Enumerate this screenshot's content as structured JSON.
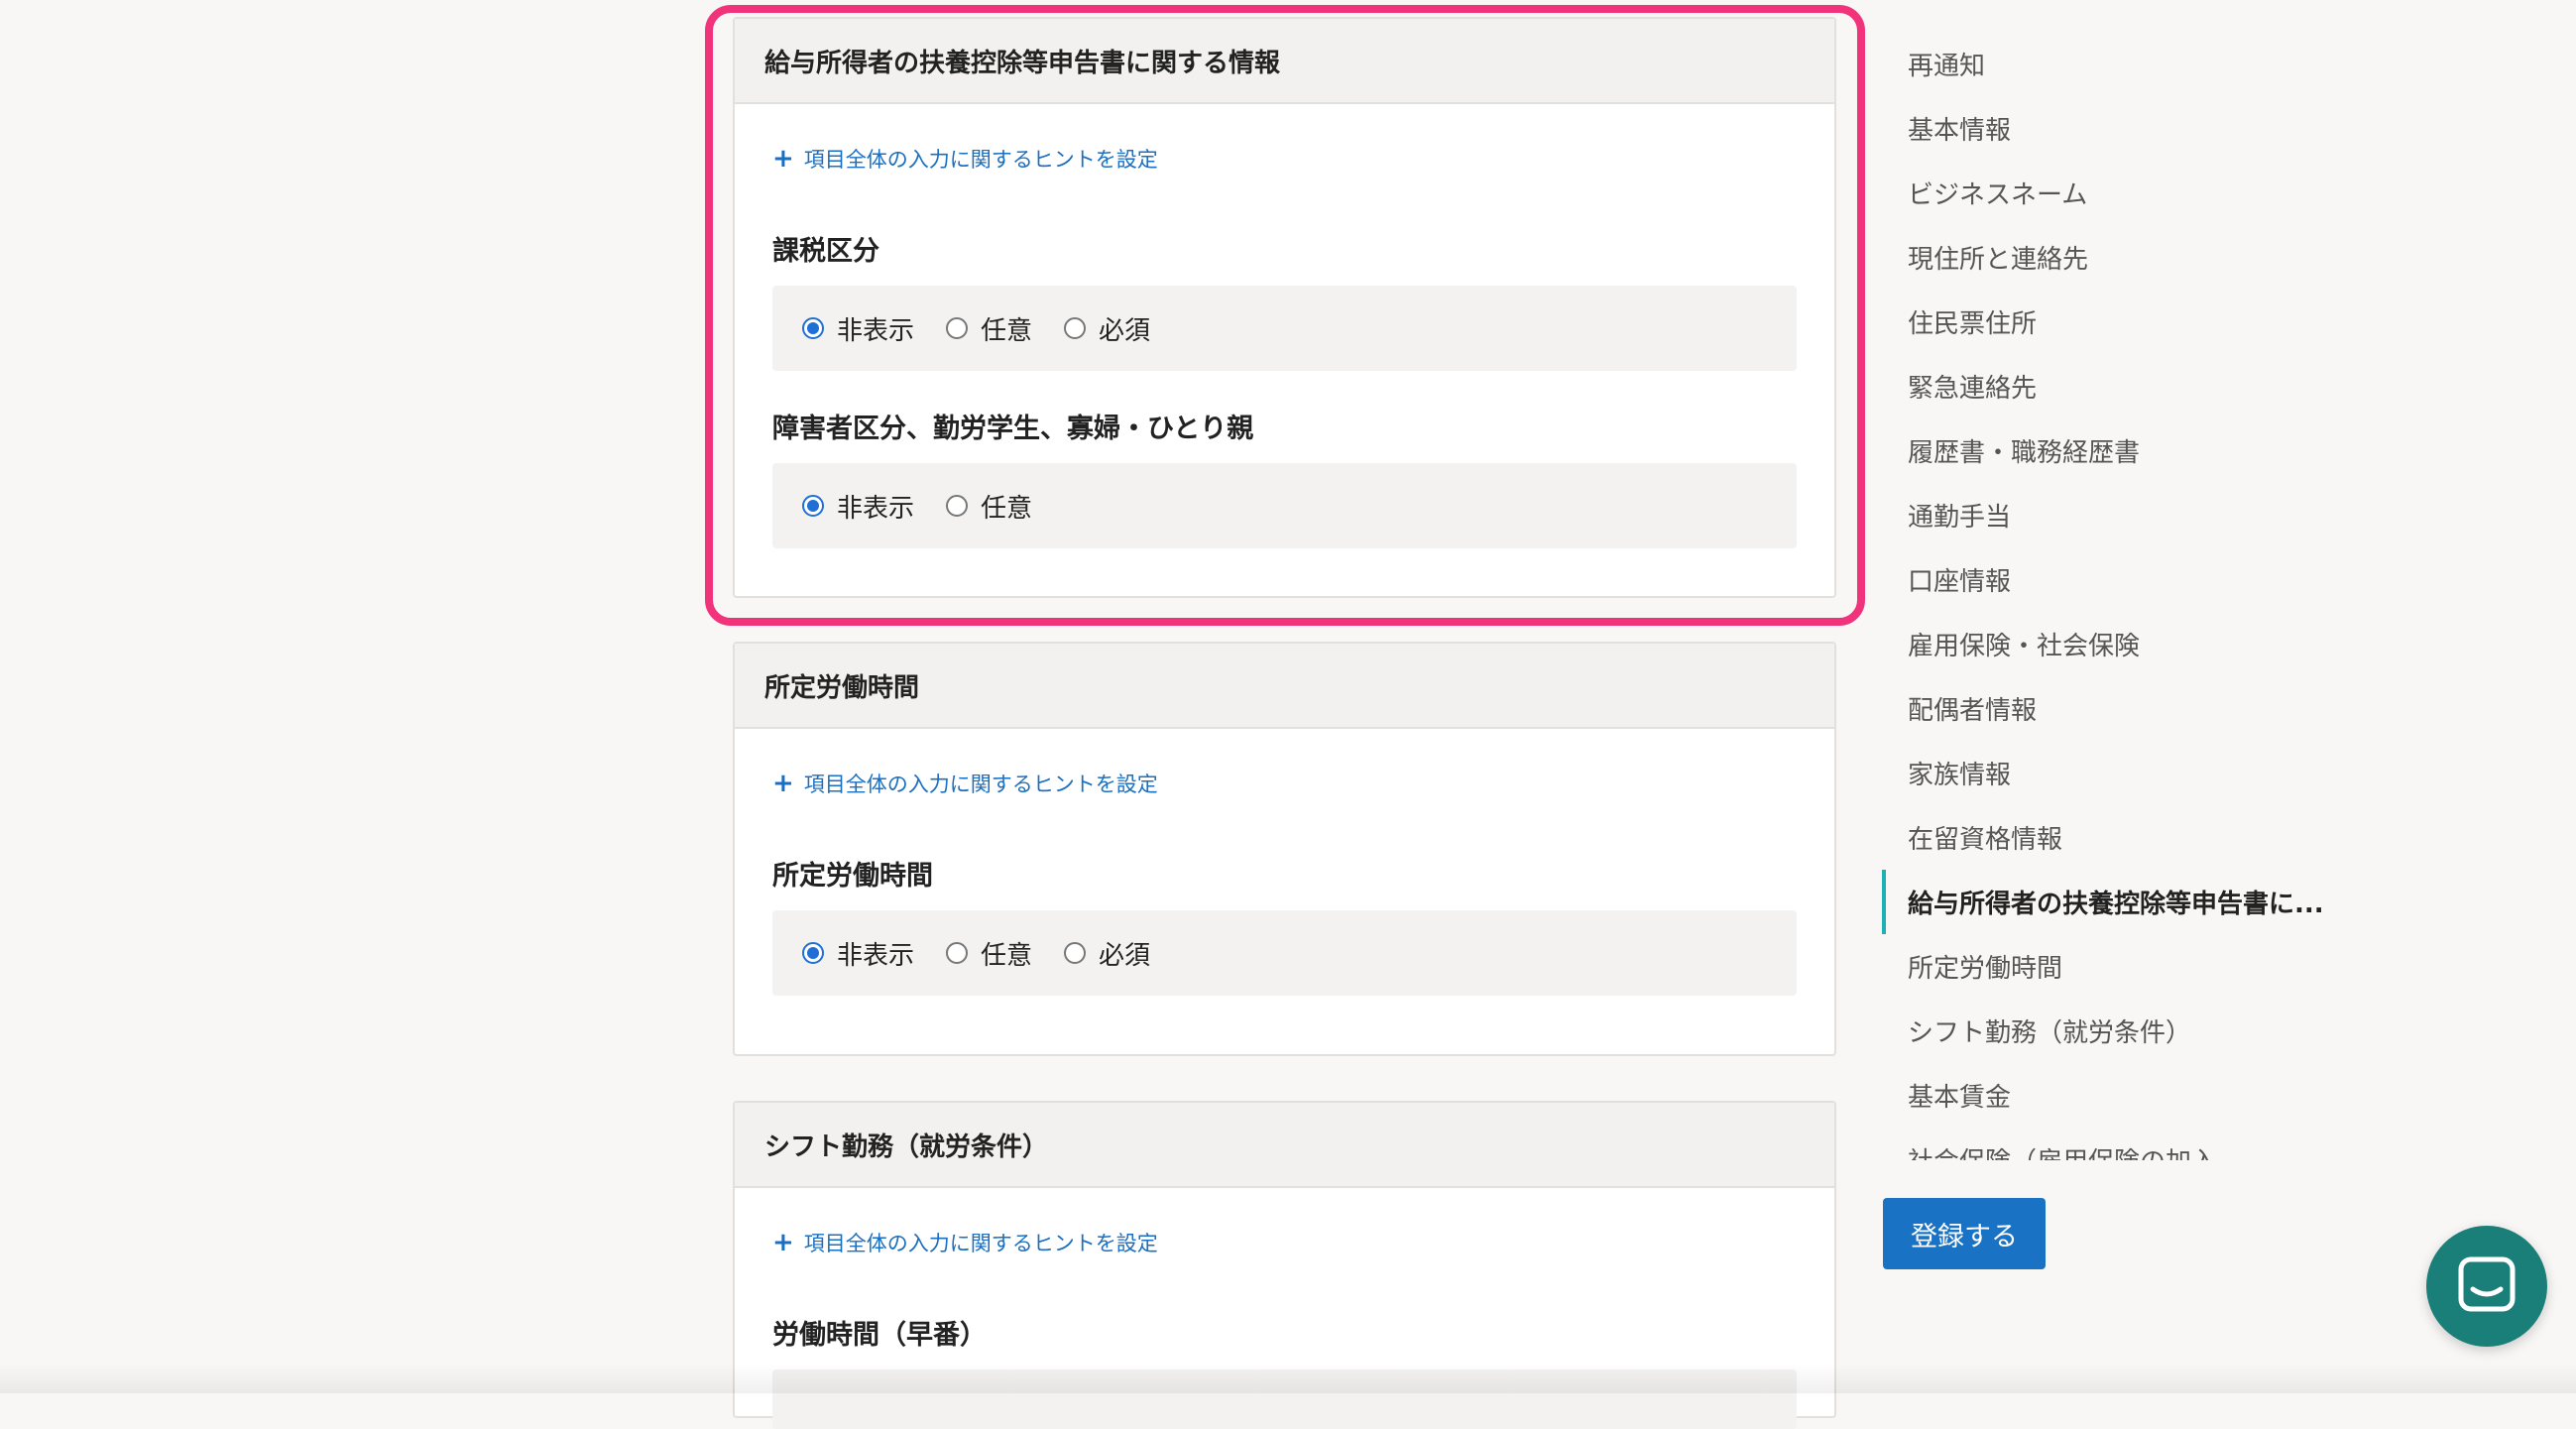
{
  "sections": [
    {
      "title": "給与所得者の扶養控除等申告書に関する情報",
      "hint": "項目全体の入力に関するヒントを設定",
      "fields": [
        {
          "label": "課税区分",
          "options": [
            "非表示",
            "任意",
            "必須"
          ],
          "selected": "非表示"
        },
        {
          "label": "障害者区分、勤労学生、寡婦・ひとり親",
          "options": [
            "非表示",
            "任意"
          ],
          "selected": "非表示"
        }
      ]
    },
    {
      "title": "所定労働時間",
      "hint": "項目全体の入力に関するヒントを設定",
      "fields": [
        {
          "label": "所定労働時間",
          "options": [
            "非表示",
            "任意",
            "必須"
          ],
          "selected": "非表示"
        }
      ]
    },
    {
      "title": "シフト勤務（就労条件）",
      "hint": "項目全体の入力に関するヒントを設定",
      "fields": [
        {
          "label": "労働時間（早番）"
        }
      ]
    }
  ],
  "sidebar": {
    "items": [
      "再通知",
      "基本情報",
      "ビジネスネーム",
      "現住所と連絡先",
      "住民票住所",
      "緊急連絡先",
      "履歴書・職務経歴書",
      "通勤手当",
      "口座情報",
      "雇用保険・社会保険",
      "配偶者情報",
      "家族情報",
      "在留資格情報",
      "給与所得者の扶養控除等申告書に...",
      "所定労働時間",
      "シフト勤務（就労条件）",
      "基本賃金",
      "社会保険（雇用保険の加入..."
    ],
    "active_index": 13
  },
  "submit_label": "登録する",
  "colors": {
    "highlight": "#f0337b",
    "primary": "#1a72c4",
    "link": "#1b6fc0",
    "active_bar": "#1fb0b5",
    "chat": "#1b7f79"
  },
  "icons": {
    "hint": "plus-icon",
    "chat": "chat-icon"
  }
}
